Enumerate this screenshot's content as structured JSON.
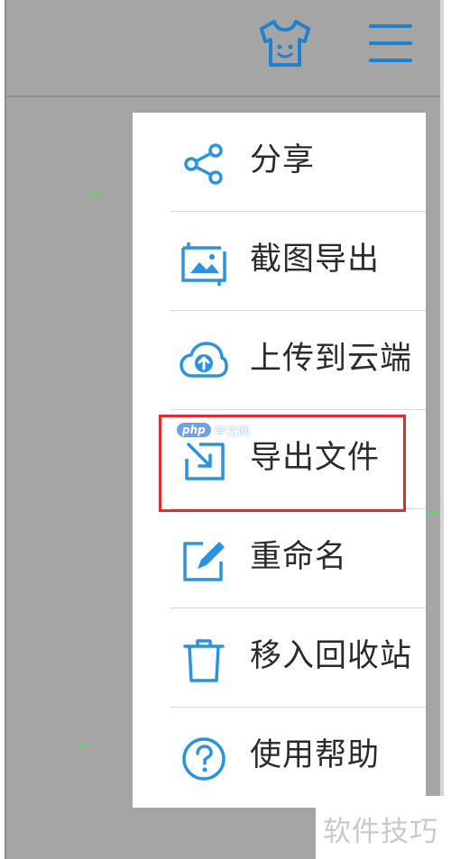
{
  "accent_color": "#2a93e0",
  "highlight_color": "#e02c2c",
  "topbar": {
    "icons": [
      "tshirt-icon",
      "hamburger-menu-icon"
    ]
  },
  "menu": {
    "items": [
      {
        "label": "分享",
        "icon": "share-icon"
      },
      {
        "label": "截图导出",
        "icon": "screenshot-export-icon"
      },
      {
        "label": "上传到云端",
        "icon": "cloud-upload-icon"
      },
      {
        "label": "导出文件",
        "icon": "export-file-icon",
        "highlighted": true
      },
      {
        "label": "重命名",
        "icon": "rename-icon"
      },
      {
        "label": "移入回收站",
        "icon": "trash-icon"
      },
      {
        "label": "使用帮助",
        "icon": "help-icon"
      }
    ]
  },
  "overlay": {
    "php_badge": "php",
    "php_site": "中文网"
  },
  "watermark": {
    "text": "软件技巧"
  }
}
